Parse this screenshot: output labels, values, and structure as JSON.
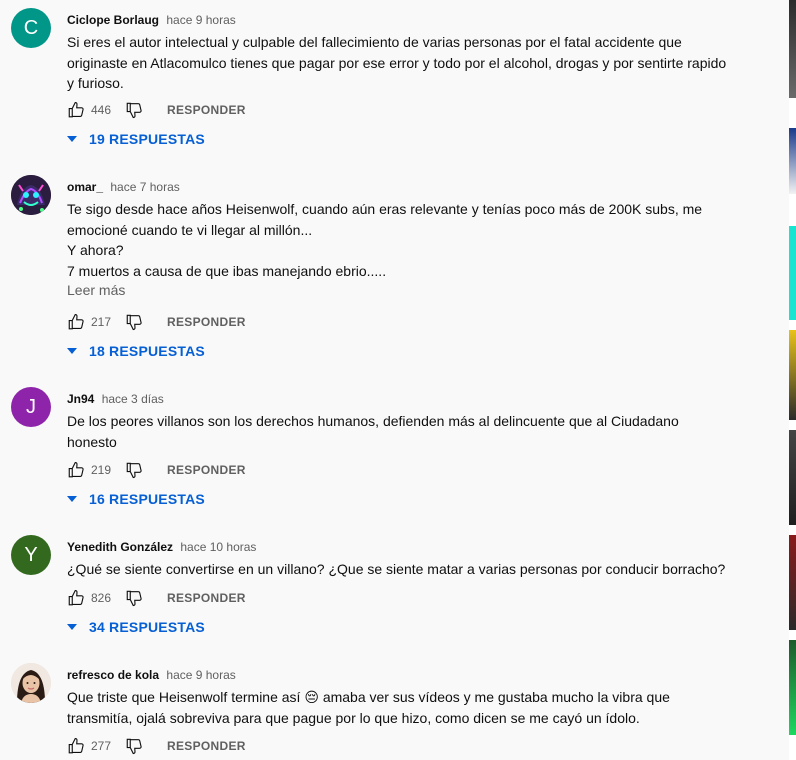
{
  "comments": [
    {
      "author": "Ciclope Borlaug",
      "time": "hace 9 horas",
      "avatar_letter": "C",
      "avatar_color": "#009688",
      "lines": [
        "Si eres el autor intelectual y culpable del fallecimiento de varias personas por el fatal accidente que",
        "originaste en Atlacomulco tienes que pagar por ese error y todo por el alcohol, drogas y por sentirte rapido",
        "y furioso."
      ],
      "likes": "446",
      "reply_label": "RESPONDER",
      "replies_label": "19 RESPUESTAS"
    },
    {
      "author": "omar_",
      "time": "hace 7 horas",
      "avatar_icon": "neon-creature-avatar",
      "lines": [
        "Te sigo desde hace años Heisenwolf, cuando aún eras relevante y tenías poco más de 200K subs, me",
        "emocioné cuando te vi llegar al millón...",
        "Y ahora?",
        "7 muertos a causa de que ibas manejando ebrio....."
      ],
      "more_label": "Leer más",
      "likes": "217",
      "reply_label": "RESPONDER",
      "replies_label": "18 RESPUESTAS"
    },
    {
      "author": "Jn94",
      "time": "hace 3 días",
      "avatar_letter": "J",
      "avatar_color": "#8e24aa",
      "lines": [
        "De los peores villanos son los derechos humanos, defienden más al delincuente que al Ciudadano",
        "honesto"
      ],
      "likes": "219",
      "reply_label": "RESPONDER",
      "replies_label": "16 RESPUESTAS"
    },
    {
      "author": "Yenedith González",
      "time": "hace 10 horas",
      "avatar_letter": "Y",
      "avatar_color": "#33691e",
      "lines": [
        "¿Qué se siente convertirse en un villano? ¿Que se siente matar a varias personas por conducir borracho?"
      ],
      "likes": "826",
      "reply_label": "RESPONDER",
      "replies_label": "34 RESPUESTAS"
    },
    {
      "author": "refresco de kola",
      "time": "hace 9 horas",
      "avatar_icon": "woman-portrait-avatar",
      "lines": [
        "Que triste que Heisenwolf termine así 😔  amaba ver sus vídeos y me gustaba mucho la vibra que",
        "transmitía, ojalá sobreviva para que pague por lo que hizo, como dicen se me cayó un ídolo."
      ],
      "likes": "277",
      "reply_label": "RESPONDER"
    }
  ],
  "colors": {
    "link_blue": "#065fd4",
    "secondary_text": "#606060",
    "background": "#f9f9f9"
  }
}
